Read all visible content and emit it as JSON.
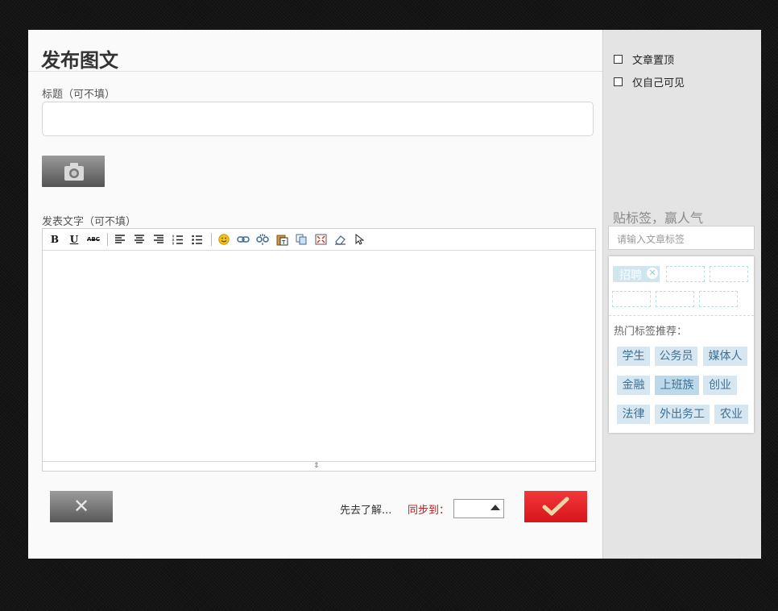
{
  "dialog": {
    "title": "发布图文"
  },
  "form": {
    "title_label": "标题（可不填）",
    "title_value": "",
    "body_label": "发表文字（可不填）",
    "toolbar": [
      {
        "name": "bold",
        "glyph": "B"
      },
      {
        "name": "underline",
        "glyph": "U"
      },
      {
        "name": "strikethrough",
        "glyph": "ABC"
      },
      {
        "name": "align-left",
        "glyph": ""
      },
      {
        "name": "align-center",
        "glyph": ""
      },
      {
        "name": "align-right",
        "glyph": ""
      },
      {
        "name": "ordered-list",
        "glyph": ""
      },
      {
        "name": "unordered-list",
        "glyph": ""
      },
      {
        "name": "emoticon",
        "glyph": ""
      },
      {
        "name": "link",
        "glyph": ""
      },
      {
        "name": "unlink",
        "glyph": ""
      },
      {
        "name": "paste-text",
        "glyph": ""
      },
      {
        "name": "copy",
        "glyph": ""
      },
      {
        "name": "fullscreen",
        "glyph": ""
      },
      {
        "name": "eraser",
        "glyph": ""
      },
      {
        "name": "select",
        "glyph": ""
      }
    ]
  },
  "actions": {
    "cancel_glyph": "✕",
    "learn_more": "先去了解...",
    "sync_label": "同步到：",
    "sync_value": ""
  },
  "options": {
    "pin_top": "文章置顶",
    "private": "仅自己可见"
  },
  "tags": {
    "heading": "贴标签，赢人气",
    "input_placeholder": "请输入文章标签",
    "selected": [
      "招聘"
    ],
    "remove_glyph": "✕",
    "hot_label": "热门标签推荐：",
    "hot": [
      "学生",
      "公务员",
      "媒体人",
      "金融",
      "上班族",
      "创业",
      "法律",
      "外出务工",
      "农业"
    ]
  },
  "colors": {
    "submit": "#e1252a",
    "tag_bg": "#d7e7f1",
    "tag_text": "#3d6f92",
    "sync_label": "#c41a1a"
  }
}
